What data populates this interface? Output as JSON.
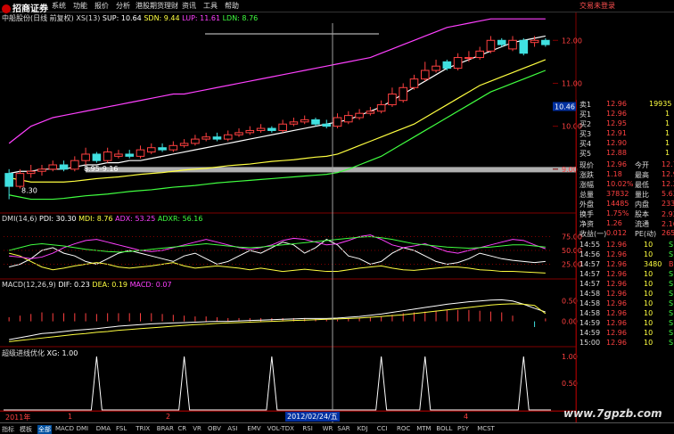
{
  "app": {
    "logo_text": "招商证券",
    "login_status": "交易未登录",
    "menu": [
      "系统",
      "功能",
      "报价",
      "分析",
      "港股期货理财",
      "资讯",
      "工具",
      "帮助"
    ]
  },
  "panes": {
    "price": {
      "title": "中船股份(日线 前复权)",
      "ma_label": "XS(13)",
      "sup": "SUP: 10.64",
      "sdn": "SDN: 9.44",
      "lup": "LUP: 11.61",
      "ldn": "LDN: 8.76",
      "yticks": [
        "12.00",
        "11.00",
        "10.00",
        "9.00"
      ],
      "cursor_price": "10.46",
      "annotations": [
        {
          "text": "8.30"
        },
        {
          "text": "8.95-9.16"
        }
      ]
    },
    "dmi": {
      "title": "DMI(14,6)",
      "pdi": "PDI: 30.30",
      "mdi": "MDI: 8.76",
      "adx": "ADX: 53.25",
      "adxr": "ADXR: 56.16",
      "yticks": [
        "75.00",
        "50.00",
        "25.00"
      ]
    },
    "macd": {
      "title": "MACD(12,26,9)",
      "dif": "DIF: 0.23",
      "dea": "DEA: 0.19",
      "macd": "MACD: 0.07",
      "yticks": [
        "0.50",
        "0.00"
      ]
    },
    "xg": {
      "title": "超级进线优化",
      "xg": "XG: 1.00",
      "yticks": [
        "1.00",
        "0.50"
      ]
    }
  },
  "colors": {
    "up": "#ff4040",
    "down": "#40e0e0",
    "mdi_line": "#ffff40",
    "pdi_line": "#ffffff",
    "adx_line": "#ff40ff",
    "adxr_line": "#40ff40",
    "grid_red": "#800000",
    "cursor_gray": "#a0a0a0"
  },
  "chart_data": [
    {
      "type": "candlestick",
      "name": "price",
      "ylim": [
        8.0,
        12.4
      ],
      "x": [
        1,
        2,
        3,
        4,
        5,
        6,
        7,
        8,
        9,
        10,
        11,
        12,
        13,
        14,
        15,
        16,
        17,
        18,
        19,
        20,
        21,
        22,
        23,
        24,
        25,
        26,
        27,
        28,
        29,
        30,
        31,
        32,
        33,
        34,
        35,
        36,
        37,
        38,
        39,
        40,
        41,
        42,
        43,
        44,
        45,
        46,
        47,
        48,
        49,
        50
      ],
      "open": [
        8.9,
        8.6,
        8.9,
        8.95,
        9.0,
        9.1,
        9.0,
        9.2,
        9.35,
        9.2,
        9.3,
        9.35,
        9.3,
        9.4,
        9.5,
        9.45,
        9.55,
        9.6,
        9.7,
        9.75,
        9.7,
        9.8,
        9.85,
        9.9,
        9.95,
        9.9,
        10.05,
        10.1,
        10.15,
        10.05,
        10.0,
        10.1,
        10.2,
        10.3,
        10.35,
        10.5,
        10.6,
        10.9,
        11.1,
        11.3,
        11.5,
        11.35,
        11.6,
        11.6,
        11.75,
        12.0,
        11.8,
        12.0,
        11.95,
        12.0
      ],
      "close": [
        8.6,
        8.9,
        8.95,
        9.0,
        9.1,
        9.0,
        9.2,
        9.35,
        9.2,
        9.4,
        9.35,
        9.3,
        9.45,
        9.5,
        9.45,
        9.55,
        9.6,
        9.7,
        9.75,
        9.7,
        9.8,
        9.85,
        9.9,
        9.95,
        9.9,
        10.05,
        10.1,
        10.15,
        10.05,
        10.0,
        10.2,
        10.25,
        10.3,
        10.35,
        10.5,
        10.75,
        10.9,
        11.1,
        11.3,
        11.4,
        11.35,
        11.6,
        11.6,
        11.75,
        12.0,
        11.9,
        12.0,
        11.7,
        12.0,
        11.9
      ],
      "high": [
        9.0,
        9.0,
        9.1,
        9.1,
        9.2,
        9.2,
        9.3,
        9.5,
        9.4,
        9.5,
        9.45,
        9.45,
        9.55,
        9.6,
        9.6,
        9.65,
        9.7,
        9.8,
        9.85,
        9.85,
        9.9,
        9.95,
        10.0,
        10.05,
        10.0,
        10.15,
        10.2,
        10.25,
        10.2,
        10.15,
        10.3,
        10.35,
        10.4,
        10.45,
        10.6,
        10.9,
        11.0,
        11.2,
        11.5,
        11.55,
        11.55,
        11.7,
        11.75,
        11.85,
        12.1,
        12.05,
        12.1,
        12.05,
        12.1,
        12.05
      ],
      "low": [
        8.3,
        8.55,
        8.8,
        8.85,
        8.95,
        8.95,
        8.95,
        9.1,
        9.15,
        9.15,
        9.25,
        9.25,
        9.25,
        9.35,
        9.4,
        9.4,
        9.5,
        9.55,
        9.65,
        9.65,
        9.65,
        9.75,
        9.8,
        9.85,
        9.85,
        9.85,
        10.0,
        10.05,
        10.0,
        9.95,
        9.95,
        10.05,
        10.15,
        10.25,
        10.3,
        10.45,
        10.55,
        10.85,
        11.05,
        11.25,
        11.3,
        11.3,
        11.5,
        11.55,
        11.7,
        11.85,
        11.75,
        11.65,
        11.85,
        11.85
      ],
      "bands": {
        "lup": [
          9.6,
          9.8,
          10.0,
          10.1,
          10.2,
          10.25,
          10.3,
          10.35,
          10.4,
          10.45,
          10.5,
          10.55,
          10.6,
          10.65,
          10.7,
          10.75,
          10.75,
          10.8,
          10.85,
          10.9,
          10.95,
          11.0,
          11.05,
          11.1,
          11.15,
          11.2,
          11.25,
          11.3,
          11.35,
          11.4,
          11.45,
          11.5,
          11.55,
          11.6,
          11.7,
          11.8,
          11.9,
          12.0,
          12.1,
          12.2,
          12.3,
          12.35,
          12.4,
          12.45,
          12.5,
          12.5,
          12.5,
          12.5,
          12.5,
          12.5
        ],
        "sup": [
          8.9,
          8.95,
          8.95,
          9.0,
          9.0,
          9.0,
          9.05,
          9.1,
          9.1,
          9.15,
          9.15,
          9.2,
          9.2,
          9.25,
          9.3,
          9.35,
          9.4,
          9.45,
          9.5,
          9.55,
          9.6,
          9.65,
          9.7,
          9.75,
          9.8,
          9.85,
          9.9,
          9.95,
          10.0,
          10.05,
          10.1,
          10.15,
          10.25,
          10.35,
          10.45,
          10.6,
          10.75,
          10.9,
          11.05,
          11.2,
          11.35,
          11.45,
          11.55,
          11.65,
          11.75,
          11.85,
          11.95,
          12.0,
          12.05,
          12.1
        ],
        "sdn": [
          8.8,
          8.75,
          8.7,
          8.7,
          8.7,
          8.7,
          8.72,
          8.75,
          8.78,
          8.8,
          8.82,
          8.85,
          8.88,
          8.9,
          8.92,
          8.95,
          8.98,
          9.0,
          9.02,
          9.05,
          9.08,
          9.1,
          9.12,
          9.15,
          9.18,
          9.2,
          9.22,
          9.25,
          9.28,
          9.3,
          9.35,
          9.45,
          9.55,
          9.65,
          9.75,
          9.85,
          9.95,
          10.05,
          10.2,
          10.35,
          10.5,
          10.65,
          10.8,
          10.95,
          11.05,
          11.15,
          11.25,
          11.35,
          11.45,
          11.55
        ],
        "ldn": [
          8.4,
          8.35,
          8.3,
          8.3,
          8.3,
          8.32,
          8.35,
          8.38,
          8.4,
          8.42,
          8.45,
          8.48,
          8.5,
          8.52,
          8.55,
          8.58,
          8.6,
          8.62,
          8.65,
          8.68,
          8.7,
          8.72,
          8.74,
          8.76,
          8.78,
          8.8,
          8.82,
          8.84,
          8.86,
          8.88,
          8.92,
          9.0,
          9.1,
          9.2,
          9.3,
          9.45,
          9.6,
          9.75,
          9.9,
          10.05,
          10.2,
          10.35,
          10.5,
          10.65,
          10.8,
          10.9,
          11.0,
          11.1,
          11.2,
          11.3
        ]
      }
    },
    {
      "type": "line",
      "name": "dmi",
      "ylim": [
        0,
        100
      ],
      "series": [
        {
          "name": "PDI",
          "values": [
            20,
            25,
            35,
            50,
            55,
            45,
            40,
            30,
            25,
            35,
            45,
            50,
            45,
            40,
            35,
            30,
            40,
            45,
            35,
            25,
            30,
            40,
            50,
            45,
            55,
            65,
            60,
            45,
            55,
            70,
            60,
            40,
            35,
            25,
            30,
            45,
            55,
            50,
            40,
            30,
            25,
            28,
            35,
            45,
            40,
            35,
            32,
            30,
            28,
            30
          ]
        },
        {
          "name": "MDI",
          "values": [
            45,
            40,
            30,
            20,
            15,
            18,
            22,
            25,
            28,
            25,
            20,
            18,
            20,
            22,
            25,
            28,
            22,
            18,
            20,
            22,
            20,
            18,
            15,
            18,
            15,
            12,
            14,
            16,
            14,
            12,
            12,
            15,
            18,
            20,
            22,
            18,
            15,
            14,
            16,
            18,
            20,
            20,
            18,
            15,
            14,
            12,
            12,
            11,
            10,
            9
          ]
        },
        {
          "name": "ADX",
          "values": [
            40,
            38,
            35,
            38,
            45,
            55,
            62,
            68,
            70,
            65,
            60,
            55,
            50,
            48,
            50,
            55,
            60,
            65,
            70,
            65,
            60,
            55,
            52,
            55,
            60,
            68,
            72,
            70,
            65,
            60,
            62,
            68,
            75,
            78,
            70,
            60,
            55,
            58,
            62,
            55,
            48,
            45,
            50,
            55,
            60,
            65,
            70,
            68,
            60,
            53
          ]
        },
        {
          "name": "ADXR",
          "values": [
            50,
            55,
            60,
            62,
            60,
            58,
            55,
            52,
            50,
            48,
            47,
            48,
            50,
            52,
            54,
            56,
            58,
            60,
            62,
            60,
            58,
            56,
            55,
            56,
            58,
            60,
            62,
            64,
            66,
            68,
            70,
            72,
            74,
            75,
            73,
            70,
            66,
            62,
            60,
            58,
            56,
            55,
            54,
            55,
            56,
            58,
            60,
            60,
            58,
            56
          ]
        }
      ]
    },
    {
      "type": "line",
      "name": "macd",
      "ylim": [
        -0.6,
        0.8
      ],
      "series": [
        {
          "name": "DIF",
          "values": [
            -0.45,
            -0.4,
            -0.35,
            -0.3,
            -0.28,
            -0.25,
            -0.22,
            -0.2,
            -0.18,
            -0.15,
            -0.12,
            -0.1,
            -0.08,
            -0.06,
            -0.05,
            -0.04,
            -0.03,
            -0.02,
            -0.01,
            0.0,
            0.0,
            0.01,
            0.02,
            0.03,
            0.04,
            0.05,
            0.06,
            0.07,
            0.07,
            0.07,
            0.08,
            0.1,
            0.12,
            0.15,
            0.18,
            0.22,
            0.26,
            0.3,
            0.34,
            0.38,
            0.42,
            0.45,
            0.48,
            0.5,
            0.52,
            0.53,
            0.5,
            0.42,
            0.32,
            0.23
          ]
        },
        {
          "name": "DEA",
          "values": [
            -0.5,
            -0.47,
            -0.44,
            -0.41,
            -0.38,
            -0.35,
            -0.32,
            -0.3,
            -0.27,
            -0.25,
            -0.22,
            -0.2,
            -0.18,
            -0.16,
            -0.14,
            -0.12,
            -0.1,
            -0.08,
            -0.07,
            -0.05,
            -0.04,
            -0.03,
            -0.02,
            -0.01,
            0.0,
            0.01,
            0.02,
            0.03,
            0.04,
            0.05,
            0.06,
            0.07,
            0.08,
            0.1,
            0.12,
            0.14,
            0.16,
            0.19,
            0.22,
            0.25,
            0.28,
            0.31,
            0.34,
            0.37,
            0.4,
            0.42,
            0.43,
            0.42,
            0.39,
            0.19
          ]
        },
        {
          "name": "MACD",
          "values": [
            0.1,
            0.14,
            0.18,
            0.22,
            0.2,
            0.2,
            0.2,
            0.2,
            0.18,
            0.2,
            0.2,
            0.2,
            0.2,
            0.2,
            0.18,
            0.16,
            0.14,
            0.12,
            0.12,
            0.1,
            0.08,
            0.08,
            0.08,
            0.08,
            0.08,
            0.08,
            0.08,
            0.08,
            0.06,
            0.04,
            0.04,
            0.06,
            0.08,
            0.1,
            0.12,
            0.16,
            0.2,
            0.22,
            0.24,
            0.26,
            0.28,
            0.28,
            0.28,
            0.26,
            0.24,
            0.22,
            0.14,
            0.0,
            -0.14,
            0.07
          ]
        }
      ]
    },
    {
      "type": "line",
      "name": "xg",
      "ylim": [
        0,
        1
      ],
      "series": [
        {
          "name": "XG",
          "values": [
            0,
            0,
            0,
            0,
            0,
            0,
            0,
            0,
            1,
            0,
            0,
            0,
            0,
            0,
            0,
            0,
            1,
            0,
            0,
            0,
            0,
            0,
            0,
            0,
            1,
            0,
            0,
            0,
            0,
            0,
            0,
            0,
            0,
            0,
            1,
            0,
            0,
            0,
            1,
            0,
            0,
            0,
            0,
            0,
            0,
            0,
            0,
            1,
            0,
            0
          ]
        }
      ]
    }
  ],
  "quote": {
    "asks": [
      {
        "label": "卖3",
        "price": "",
        "vol": ""
      },
      {
        "label": "卖2",
        "price": "",
        "vol": ""
      },
      {
        "label": "卖1",
        "price": "12.96",
        "vol": "19935"
      }
    ],
    "bids": [
      {
        "label": "买1",
        "price": "12.96",
        "vol": "1"
      },
      {
        "label": "买2",
        "price": "12.95",
        "vol": "1"
      },
      {
        "label": "买3",
        "price": "12.91",
        "vol": "1"
      },
      {
        "label": "买4",
        "price": "12.90",
        "vol": "1"
      },
      {
        "label": "买5",
        "price": "12.88",
        "vol": "1"
      }
    ],
    "stats": [
      {
        "l1": "现价",
        "v1": "12.96",
        "l2": "今开",
        "v2": "12.78"
      },
      {
        "l1": "涨跌",
        "v1": "1.18",
        "l2": "最高",
        "v2": "12.96"
      },
      {
        "l1": "涨幅",
        "v1": "10.02%",
        "l2": "最低",
        "v2": "12.29"
      },
      {
        "l1": "总量",
        "v1": "37832",
        "l2": "量比",
        "v2": "5.63"
      },
      {
        "l1": "外盘",
        "v1": "14485",
        "l2": "内盘",
        "v2": "23347"
      },
      {
        "l1": "换手",
        "v1": "1.75%",
        "l2": "股本",
        "v2": "2.92亿"
      },
      {
        "l1": "净资",
        "v1": "1.26",
        "l2": "流通",
        "v2": "2.16亿"
      },
      {
        "l1": "收益(一)",
        "v1": "0.012",
        "l2": "PE(动)",
        "v2": "265.1"
      }
    ],
    "ticks": [
      {
        "t": "14:55",
        "p": "12.96",
        "v": "10",
        "s": "S"
      },
      {
        "t": "14:56",
        "p": "12.96",
        "v": "10",
        "s": "S"
      },
      {
        "t": "14:57",
        "p": "12.96",
        "v": "3480",
        "s": "B"
      },
      {
        "t": "14:57",
        "p": "12.96",
        "v": "10",
        "s": "S"
      },
      {
        "t": "14:57",
        "p": "12.96",
        "v": "10",
        "s": "S"
      },
      {
        "t": "14:58",
        "p": "12.96",
        "v": "10",
        "s": "S"
      },
      {
        "t": "14:58",
        "p": "12.96",
        "v": "10",
        "s": "S"
      },
      {
        "t": "14:58",
        "p": "12.96",
        "v": "10",
        "s": "S"
      },
      {
        "t": "14:59",
        "p": "12.96",
        "v": "10",
        "s": "S"
      },
      {
        "t": "14:59",
        "p": "12.96",
        "v": "10",
        "s": "S"
      },
      {
        "t": "15:00",
        "p": "12.96",
        "v": "10",
        "s": "S"
      }
    ]
  },
  "dates": {
    "year": "2011年",
    "m1": "1",
    "m2": "2",
    "cursor_date": "2012/02/24/五",
    "m4": "4"
  },
  "bottom_tabs": [
    "指标",
    "模板",
    "全部",
    "MACD",
    "DMI",
    "DMA",
    "FSL",
    "TRIX",
    "BRAR",
    "CR",
    "VR",
    "OBV",
    "ASI",
    "EMV",
    "VOL-TDX",
    "RSI",
    "WR",
    "SAR",
    "KDJ",
    "CCI",
    "ROC",
    "MTM",
    "BOLL",
    "PSY",
    "MCST"
  ],
  "active_tab": "全部",
  "watermark": "www.7gpzb.com"
}
